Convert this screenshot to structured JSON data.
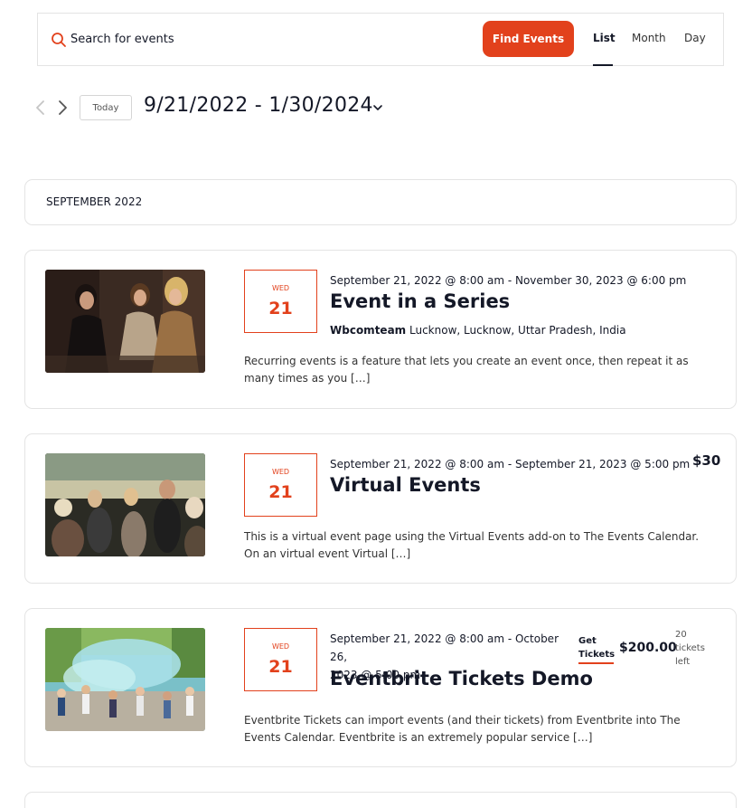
{
  "search": {
    "placeholder": "Search for events",
    "find_button": "Find Events",
    "views": [
      "List",
      "Month",
      "Day"
    ],
    "active_view": "List"
  },
  "date_nav": {
    "today_label": "Today",
    "range": "9/21/2022 - 1/30/2024"
  },
  "month_separator": "SEPTEMBER 2022",
  "events": [
    {
      "dow": "WED",
      "day": "21",
      "datetime": "September 21, 2022 @ 8:00 am - November 30, 2023 @ 6:00 pm",
      "title": "Event in a Series",
      "venue_name": "Wbcomteam",
      "venue_address": "Lucknow, Lucknow, Uttar Pradesh, India",
      "description": "Recurring events is a feature that lets you create an event once, then repeat it as many times as you […]"
    },
    {
      "dow": "WED",
      "day": "21",
      "datetime": "September 21, 2022 @ 8:00 am - September 21, 2023 @ 5:00 pm",
      "title": "Virtual Events",
      "cost": "$30",
      "description": "This is a virtual event page using the Virtual Events add-on to The Events Calendar. On an virtual event Virtual […]"
    },
    {
      "dow": "WED",
      "day": "21",
      "datetime_line1": "September 21, 2022 @ 8:00 am - October 26,",
      "datetime_line2": "2023 @ 5:00 pm",
      "title": "Eventbrite Tickets Demo",
      "get_tickets_line1": "Get",
      "get_tickets_line2": "Tickets",
      "cost": "$200.00",
      "tickets_left_line1": "20",
      "tickets_left_line2": "tickets",
      "tickets_left_line3": "left",
      "description": "Eventbrite Tickets can import events (and their tickets) from Eventbrite into The Events Calendar. Eventbrite is an extremely popular service […]"
    }
  ],
  "colors": {
    "accent": "#e2411c",
    "text": "#141827",
    "border": "#e4e4e4"
  }
}
